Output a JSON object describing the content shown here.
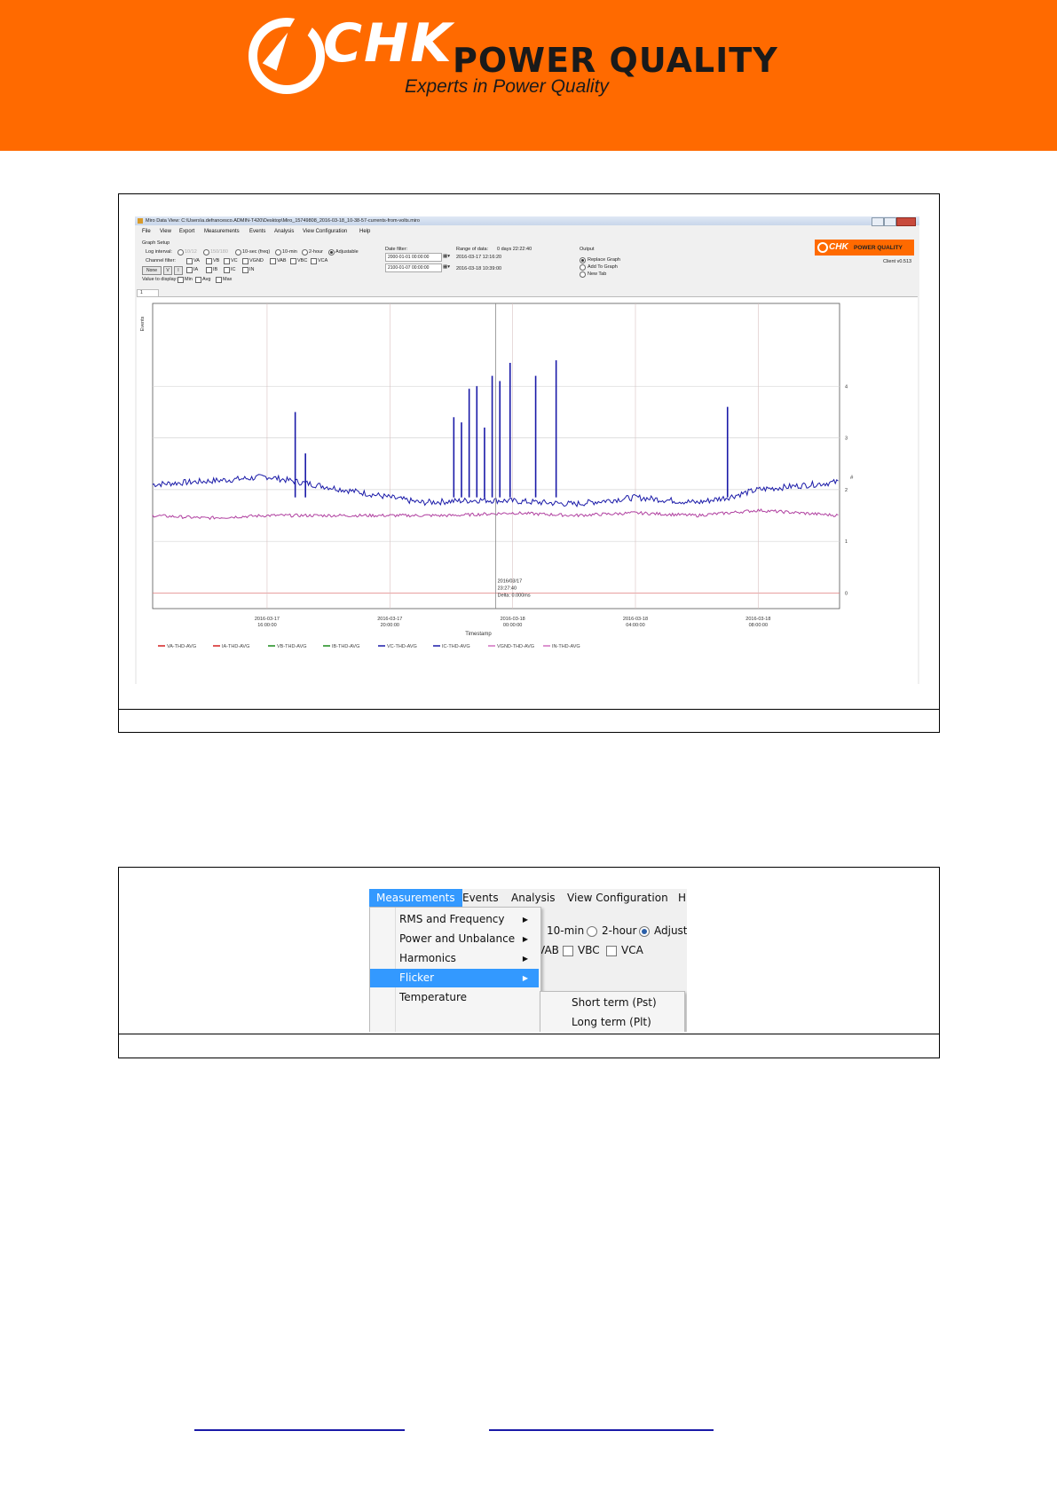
{
  "header": {
    "brand_chk": "CHK",
    "brand_pq": "POWER QUALITY",
    "tagline": "Experts in Power Quality",
    "bg_color": "#ff6a00"
  },
  "figure1": {
    "window_title": "Miro Data View: C:\\Users\\a.defrancesco.ADMIN-T420\\Desktop\\Miro_15749808_2016-03-18_10-38-57-currents-from-volts.miro",
    "menu": [
      "File",
      "View",
      "Export",
      "Measurements",
      "Events",
      "Analysis",
      "View Configuration",
      "Help"
    ],
    "graph_setup_label": "Graph Setup",
    "log_interval_label": "Log interval:",
    "log_intervals": [
      "10/12",
      "150/180",
      "10-sec (freq)",
      "10-min",
      "2-hour",
      "Adjustable"
    ],
    "channel_filter_label": "Channel filter:",
    "channel_buttons": [
      "None",
      "V",
      "I"
    ],
    "channels_row1": [
      "VA",
      "VB",
      "VC",
      "VGND",
      "VAB",
      "VBC",
      "VCA"
    ],
    "channels_row2": [
      "IA",
      "IB",
      "IC",
      "IN"
    ],
    "value_label": "Value to display:",
    "values": [
      "Min",
      "Avg",
      "Max"
    ],
    "date_filter_label": "Date filter:",
    "date_from": "2000-01-01 00:00:00",
    "date_to": "2100-01-07 00:00:00",
    "range_label": "Range of data:",
    "range_value": "0 days 22:22:40",
    "range_start": "2016-03-17 12:16:20",
    "range_end": "2016-03-18 10:39:00",
    "output_label": "Output",
    "outputs": [
      "Replace Graph",
      "Add To Graph",
      "New Tab"
    ],
    "client_version": "Client v0.513",
    "tab_label": "1",
    "events_axis": "Events",
    "x_axis_title": "Timestamp",
    "y_unit": "#",
    "cursor_date": "2016/03/17",
    "cursor_time": "23:27:40",
    "cursor_delta": "Delta: 0.000ms",
    "x_ticks": [
      {
        "d": "2016-03-17",
        "t": "16:00:00"
      },
      {
        "d": "2016-03-17",
        "t": "20:00:00"
      },
      {
        "d": "2016-03-18",
        "t": "00:00:00"
      },
      {
        "d": "2016-03-18",
        "t": "04:00:00"
      },
      {
        "d": "2016-03-18",
        "t": "08:00:00"
      }
    ],
    "y_ticks": [
      "4",
      "3",
      "2",
      "1",
      "0"
    ],
    "legend": [
      {
        "label": "VA-THD-AVG",
        "color": "#d42020"
      },
      {
        "label": "IA-THD-AVG",
        "color": "#d42020"
      },
      {
        "label": "VB-THD-AVG",
        "color": "#1a8a1a"
      },
      {
        "label": "IB-THD-AVG",
        "color": "#1a8a1a"
      },
      {
        "label": "VC-THD-AVG",
        "color": "#1a1aa8"
      },
      {
        "label": "IC-THD-AVG",
        "color": "#1a1aa8"
      },
      {
        "label": "VGND-THD-AVG",
        "color": "#d070c0"
      },
      {
        "label": "IN-THD-AVG",
        "color": "#d070c0"
      }
    ],
    "mini_logo": {
      "chk": "CHK",
      "pq": "POWER QUALITY"
    }
  },
  "chart_data": {
    "type": "line",
    "title": "",
    "xlabel": "Timestamp",
    "ylabel": "#",
    "x_range": [
      "2016-03-17 12:16:20",
      "2016-03-18 10:39:00"
    ],
    "ylim": [
      -0.3,
      5.6
    ],
    "grid": true,
    "legend_position": "bottom",
    "series": [
      {
        "name": "IC-THD-AVG",
        "color": "#1a1aa8",
        "baseline_points": [
          {
            "x": "2016-03-17 12:16",
            "y": 2.1
          },
          {
            "x": "2016-03-17 15:00",
            "y": 2.2
          },
          {
            "x": "2016-03-17 16:00",
            "y": 2.25
          },
          {
            "x": "2016-03-17 18:00",
            "y": 2.05
          },
          {
            "x": "2016-03-17 20:00",
            "y": 1.85
          },
          {
            "x": "2016-03-17 21:00",
            "y": 1.75
          },
          {
            "x": "2016-03-17 23:00",
            "y": 1.8
          },
          {
            "x": "2016-03-18 00:00",
            "y": 1.78
          },
          {
            "x": "2016-03-18 02:00",
            "y": 1.72
          },
          {
            "x": "2016-03-18 04:00",
            "y": 1.85
          },
          {
            "x": "2016-03-18 06:00",
            "y": 1.75
          },
          {
            "x": "2016-03-18 07:00",
            "y": 1.85
          },
          {
            "x": "2016-03-18 08:00",
            "y": 2.0
          },
          {
            "x": "2016-03-18 10:39",
            "y": 2.15
          }
        ],
        "spikes": [
          {
            "x": "2016-03-17 16:55",
            "y": 3.5
          },
          {
            "x": "2016-03-17 17:15",
            "y": 2.7
          },
          {
            "x": "2016-03-17 22:05",
            "y": 3.4
          },
          {
            "x": "2016-03-17 22:20",
            "y": 3.3
          },
          {
            "x": "2016-03-17 22:35",
            "y": 3.95
          },
          {
            "x": "2016-03-17 22:50",
            "y": 4.0
          },
          {
            "x": "2016-03-17 23:05",
            "y": 3.2
          },
          {
            "x": "2016-03-17 23:20",
            "y": 4.2
          },
          {
            "x": "2016-03-17 23:35",
            "y": 4.1
          },
          {
            "x": "2016-03-17 23:55",
            "y": 4.45
          },
          {
            "x": "2016-03-18 00:45",
            "y": 4.2
          },
          {
            "x": "2016-03-18 01:25",
            "y": 4.5
          },
          {
            "x": "2016-03-18 07:00",
            "y": 3.6
          }
        ]
      },
      {
        "name": "VGND-THD-AVG",
        "color": "#b040a0",
        "baseline_points": [
          {
            "x": "2016-03-17 12:16",
            "y": 1.5
          },
          {
            "x": "2016-03-17 14:00",
            "y": 1.45
          },
          {
            "x": "2016-03-17 16:00",
            "y": 1.5
          },
          {
            "x": "2016-03-17 20:00",
            "y": 1.5
          },
          {
            "x": "2016-03-17 22:00",
            "y": 1.5
          },
          {
            "x": "2016-03-18 00:00",
            "y": 1.55
          },
          {
            "x": "2016-03-18 02:00",
            "y": 1.5
          },
          {
            "x": "2016-03-18 04:00",
            "y": 1.55
          },
          {
            "x": "2016-03-18 06:00",
            "y": 1.5
          },
          {
            "x": "2016-03-18 08:00",
            "y": 1.6
          },
          {
            "x": "2016-03-18 10:39",
            "y": 1.5
          }
        ]
      }
    ]
  },
  "figure2": {
    "menu_bar": [
      "Measurements",
      "Events",
      "Analysis",
      "View Configuration",
      "H"
    ],
    "menu_items": [
      {
        "label": "RMS and Frequency",
        "submenu": true
      },
      {
        "label": "Power and Unbalance",
        "submenu": true
      },
      {
        "label": "Harmonics",
        "submenu": true
      },
      {
        "label": "Flicker",
        "submenu": true,
        "selected": true
      },
      {
        "label": "Temperature",
        "submenu": false
      }
    ],
    "submenu_items": [
      "Short term (Pst)",
      "Long term (Plt)"
    ],
    "bg_radios": [
      "10-min",
      "2-hour",
      "Adjusta"
    ],
    "bg_checks": [
      "VAB",
      "VBC",
      "VCA"
    ],
    "highlight": "#3399ff"
  }
}
